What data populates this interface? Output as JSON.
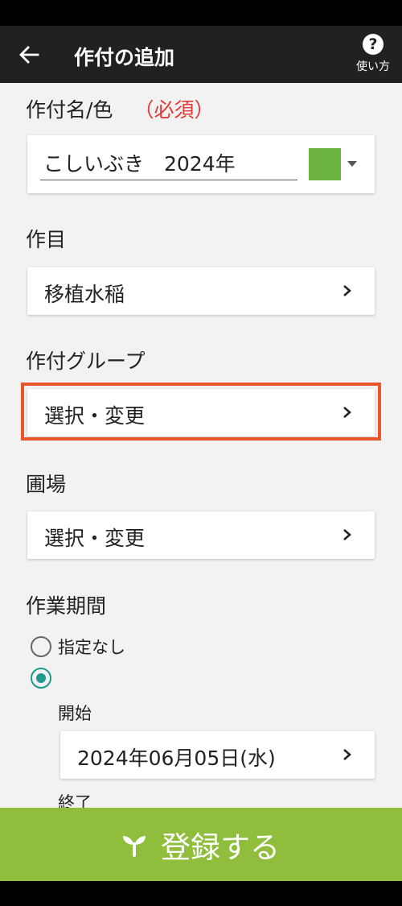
{
  "header": {
    "title": "作付の追加",
    "help_label": "使い方"
  },
  "crop_name_section": {
    "label": "作付名/色",
    "required": "（必須）",
    "name_value": "こしいぶき　2024年",
    "color": "#6db33f"
  },
  "crop_type_section": {
    "label": "作目",
    "value": "移植水稲"
  },
  "crop_group_section": {
    "label": "作付グループ",
    "value": "選択・変更"
  },
  "field_section": {
    "label": "圃場",
    "value": "選択・変更"
  },
  "work_period_section": {
    "label": "作業期間",
    "option_none": "指定なし",
    "selected_option": "specified",
    "start_label": "開始",
    "start_date": "2024年06月05日(水)",
    "end_label": "終了"
  },
  "footer": {
    "register_label": "登録する"
  },
  "colors": {
    "appbar": "#212121",
    "background": "#f2f2f2",
    "required": "#e53935",
    "highlight": "#e8562a",
    "radio_accent": "#1f9a8e",
    "register_bar": "#8fbe3c"
  },
  "icons": {
    "back": "arrow-left-icon",
    "help": "question-circle-icon",
    "chevron": "chevron-right-icon",
    "dropdown": "caret-down-icon",
    "register": "sprout-icon"
  }
}
